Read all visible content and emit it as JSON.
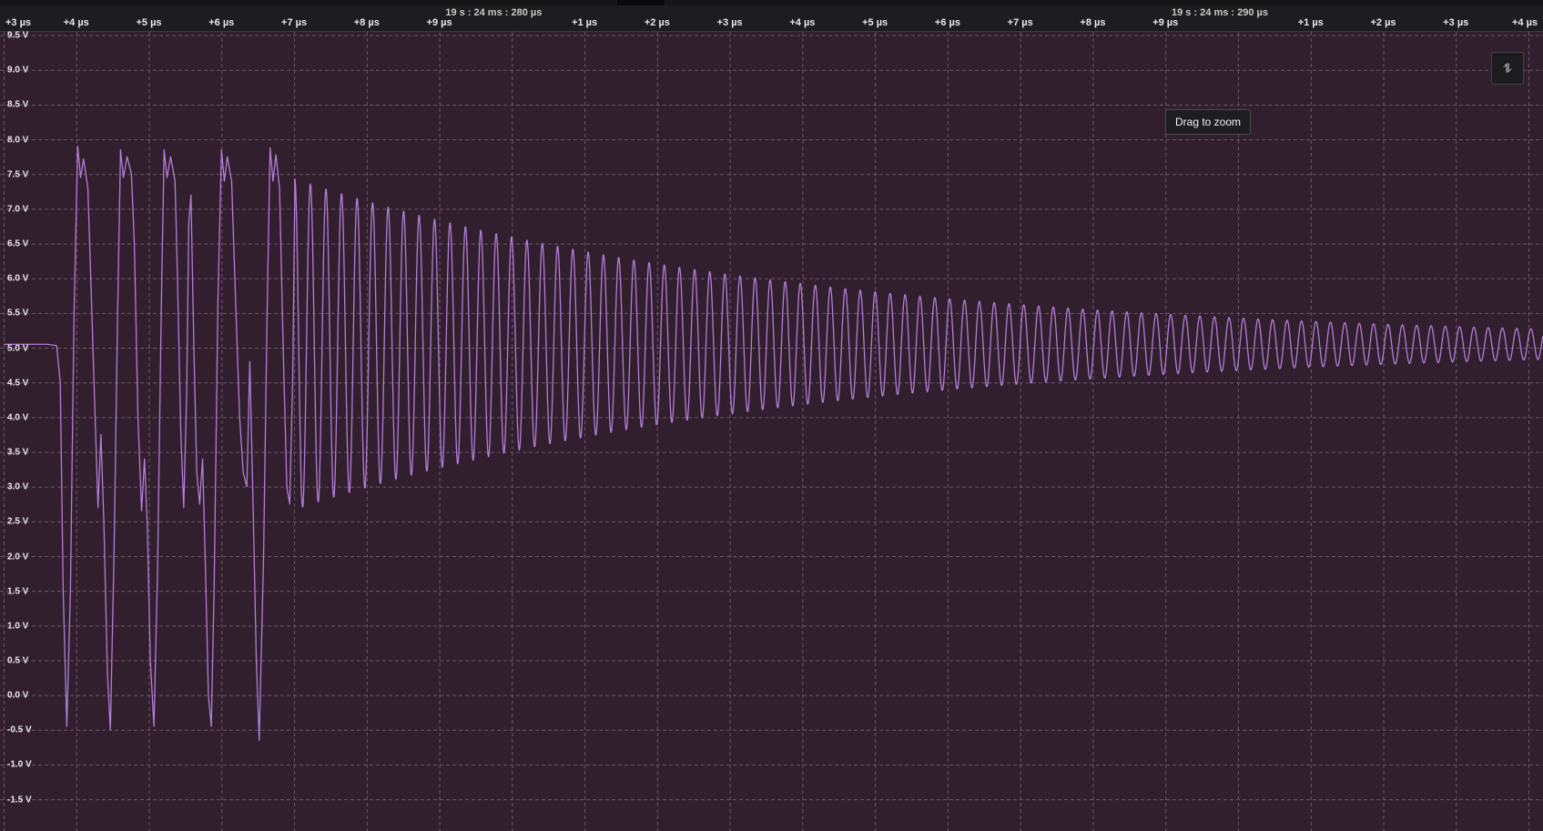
{
  "ruler": {
    "absolute_labels": [
      {
        "text": "19 s : 24 ms : 280 µs",
        "t_us": 280
      },
      {
        "text": "19 s : 24 ms : 290 µs",
        "t_us": 290
      }
    ],
    "ticks": [
      {
        "label": "+3 µs",
        "t_us": 273
      },
      {
        "label": "+4 µs",
        "t_us": 274
      },
      {
        "label": "+5 µs",
        "t_us": 275
      },
      {
        "label": "+6 µs",
        "t_us": 276
      },
      {
        "label": "+7 µs",
        "t_us": 277
      },
      {
        "label": "+8 µs",
        "t_us": 278
      },
      {
        "label": "+9 µs",
        "t_us": 279
      },
      {
        "label": "+1 µs",
        "t_us": 281
      },
      {
        "label": "+2 µs",
        "t_us": 282
      },
      {
        "label": "+3 µs",
        "t_us": 283
      },
      {
        "label": "+4 µs",
        "t_us": 284
      },
      {
        "label": "+5 µs",
        "t_us": 285
      },
      {
        "label": "+6 µs",
        "t_us": 286
      },
      {
        "label": "+7 µs",
        "t_us": 287
      },
      {
        "label": "+8 µs",
        "t_us": 288
      },
      {
        "label": "+9 µs",
        "t_us": 289
      },
      {
        "label": "+1 µs",
        "t_us": 291
      },
      {
        "label": "+2 µs",
        "t_us": 292
      },
      {
        "label": "+3 µs",
        "t_us": 293
      },
      {
        "label": "+4 µs",
        "t_us": 294
      }
    ]
  },
  "tooltip": {
    "text": "Drag to zoom"
  },
  "colors": {
    "background": "#321f2e",
    "grid": "#6b5566",
    "trace": "#b07fd8",
    "ruler": "#1d1d1f"
  },
  "icons": {
    "fit_button": "fit-vertical-icon"
  },
  "chart_data": {
    "type": "line",
    "xlabel": "",
    "ylabel": "",
    "x_unit": "µs",
    "xlim": [
      272.95,
      294.2
    ],
    "ylim": [
      -1.8,
      9.6
    ],
    "y_ticks": [
      {
        "label": "9.5 V",
        "value": 9.5
      },
      {
        "label": "9.0 V",
        "value": 9.0
      },
      {
        "label": "8.5 V",
        "value": 8.5
      },
      {
        "label": "8.0 V",
        "value": 8.0
      },
      {
        "label": "7.5 V",
        "value": 7.5
      },
      {
        "label": "7.0 V",
        "value": 7.0
      },
      {
        "label": "6.5 V",
        "value": 6.5
      },
      {
        "label": "6.0 V",
        "value": 6.0
      },
      {
        "label": "5.5 V",
        "value": 5.5
      },
      {
        "label": "5.0 V",
        "value": 5.0
      },
      {
        "label": "4.5 V",
        "value": 4.5
      },
      {
        "label": "4.0 V",
        "value": 4.0
      },
      {
        "label": "3.5 V",
        "value": 3.5
      },
      {
        "label": "3.0 V",
        "value": 3.0
      },
      {
        "label": "2.5 V",
        "value": 2.5
      },
      {
        "label": "2.0 V",
        "value": 2.0
      },
      {
        "label": "1.5 V",
        "value": 1.5
      },
      {
        "label": "1.0 V",
        "value": 1.0
      },
      {
        "label": "0.5 V",
        "value": 0.5
      },
      {
        "label": "0.0 V",
        "value": 0.0
      },
      {
        "label": "-0.5 V",
        "value": -0.5
      },
      {
        "label": "-1.0 V",
        "value": -1.0
      },
      {
        "label": "-1.5 V",
        "value": -1.5
      }
    ],
    "grid": true,
    "series": [
      {
        "points": [
          [
            273.0,
            5.05
          ],
          [
            273.6,
            5.05
          ],
          [
            273.73,
            5.03
          ],
          [
            273.78,
            4.5
          ],
          [
            273.82,
            1.5
          ],
          [
            273.87,
            -0.45
          ],
          [
            273.92,
            1.5
          ],
          [
            273.97,
            5.5
          ],
          [
            274.02,
            7.9
          ],
          [
            274.06,
            7.45
          ],
          [
            274.1,
            7.72
          ],
          [
            274.16,
            7.3
          ],
          [
            274.2,
            6.0
          ],
          [
            274.26,
            4.0
          ],
          [
            274.3,
            2.7
          ],
          [
            274.34,
            3.75
          ],
          [
            274.38,
            2.5
          ],
          [
            274.43,
            0.3
          ],
          [
            274.47,
            -0.5
          ],
          [
            274.52,
            2.0
          ],
          [
            274.57,
            5.5
          ],
          [
            274.61,
            7.85
          ],
          [
            274.65,
            7.45
          ],
          [
            274.7,
            7.75
          ],
          [
            274.76,
            7.5
          ],
          [
            274.8,
            6.5
          ],
          [
            274.85,
            4.0
          ],
          [
            274.9,
            2.65
          ],
          [
            274.94,
            3.4
          ],
          [
            274.98,
            2.4
          ],
          [
            275.02,
            0.5
          ],
          [
            275.07,
            -0.45
          ],
          [
            275.12,
            1.8
          ],
          [
            275.17,
            5.5
          ],
          [
            275.21,
            7.85
          ],
          [
            275.25,
            7.45
          ],
          [
            275.3,
            7.75
          ],
          [
            275.36,
            7.4
          ],
          [
            275.39,
            6.2
          ],
          [
            275.44,
            3.8
          ],
          [
            275.48,
            2.7
          ],
          [
            275.52,
            4.3
          ],
          [
            275.55,
            6.8
          ],
          [
            275.58,
            7.2
          ],
          [
            275.62,
            5.0
          ],
          [
            275.66,
            3.2
          ],
          [
            275.7,
            2.75
          ],
          [
            275.74,
            3.4
          ],
          [
            275.78,
            1.8
          ],
          [
            275.82,
            0.0
          ],
          [
            275.86,
            -0.45
          ],
          [
            275.9,
            1.6
          ],
          [
            275.95,
            5.6
          ],
          [
            276.0,
            7.85
          ],
          [
            276.04,
            7.4
          ],
          [
            276.08,
            7.75
          ],
          [
            276.14,
            7.4
          ],
          [
            276.2,
            5.5
          ],
          [
            276.25,
            4.0
          ],
          [
            276.3,
            3.2
          ],
          [
            276.35,
            3.0
          ],
          [
            276.39,
            4.8
          ],
          [
            276.43,
            3.0
          ],
          [
            276.48,
            0.5
          ],
          [
            276.52,
            -0.65
          ],
          [
            276.58,
            2.0
          ],
          [
            276.63,
            5.6
          ],
          [
            276.67,
            7.88
          ],
          [
            276.71,
            7.4
          ],
          [
            276.75,
            7.78
          ],
          [
            276.8,
            7.3
          ],
          [
            276.85,
            5.0
          ],
          [
            276.9,
            3.0
          ],
          [
            276.94,
            2.75
          ],
          [
            276.98,
            4.5
          ],
          [
            277.01,
            7.2
          ]
        ]
      }
    ]
  }
}
